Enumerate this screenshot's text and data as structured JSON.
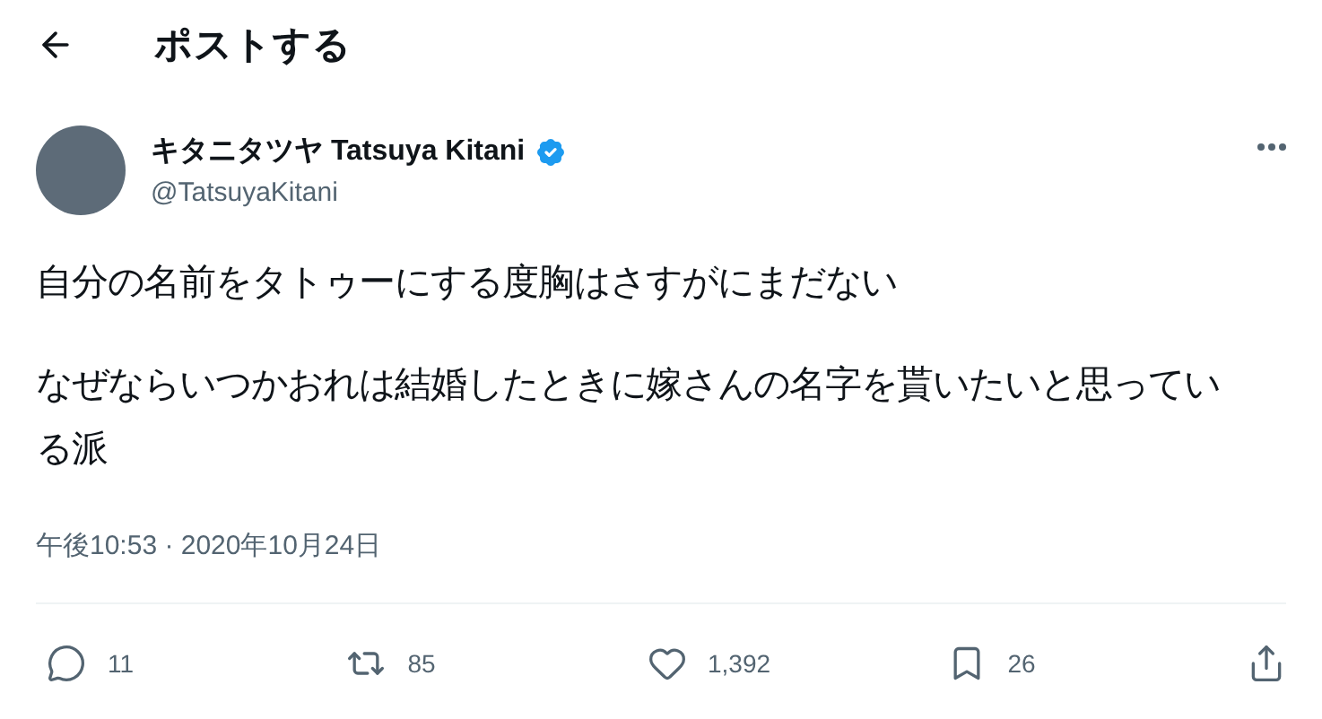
{
  "header": {
    "title": "ポストする"
  },
  "author": {
    "name": "キタニタツヤ Tatsuya Kitani",
    "handle": "@TatsuyaKitani",
    "verified": true
  },
  "post": {
    "paragraphs": [
      "自分の名前をタトゥーにする度胸はさすがにまだない",
      "なぜならいつかおれは結婚したときに嫁さんの名字を貰いたいと思っている派"
    ],
    "timestamp": "午後10:53 · 2020年10月24日"
  },
  "actions": [
    {
      "kind": "reply",
      "count": "11"
    },
    {
      "kind": "repost",
      "count": "85"
    },
    {
      "kind": "like",
      "count": "1,392"
    },
    {
      "kind": "bookmark",
      "count": "26"
    },
    {
      "kind": "share"
    }
  ]
}
